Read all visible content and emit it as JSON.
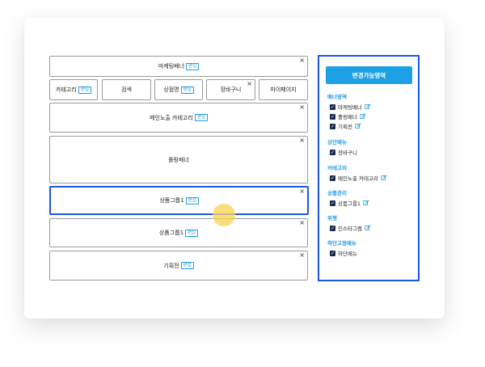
{
  "left": {
    "marketing_banner": {
      "label": "마케팅배너",
      "tag": "편집",
      "close": "×"
    },
    "category": {
      "label": "카테고리",
      "tag": "편집"
    },
    "search": {
      "label": "검색"
    },
    "product_name": {
      "label": "상점명",
      "tag": "편집"
    },
    "cart": {
      "label": "장바구니",
      "close": "×"
    },
    "mypage": {
      "label": "마이페이지"
    },
    "main_category": {
      "label": "메인노출 카테고리",
      "tag": "편집",
      "close": "×"
    },
    "rolling_banner": {
      "label": "롤링배너",
      "close": "×"
    },
    "product_group_1": {
      "label": "상품그룹1",
      "tag": "편집",
      "close": "×"
    },
    "product_group_2": {
      "label": "상품그룹1",
      "tag": "편집",
      "close": "×"
    },
    "special": {
      "label": "기획전",
      "tag": "편집",
      "close": "×"
    }
  },
  "right": {
    "button": "변경가능영역",
    "groups": [
      {
        "title": "배너영역",
        "items": [
          {
            "label": "마케팅배너",
            "edit": true
          },
          {
            "label": "롤링배너",
            "edit": true
          },
          {
            "label": "기획전",
            "edit": true
          }
        ]
      },
      {
        "title": "상단메뉴",
        "items": [
          {
            "label": "장바구니",
            "edit": false
          }
        ]
      },
      {
        "title": "카테고리",
        "items": [
          {
            "label": "메인노출 카테고리",
            "edit": true
          }
        ]
      },
      {
        "title": "상품관리",
        "items": [
          {
            "label": "상품그룹1",
            "edit": true
          }
        ]
      },
      {
        "title": "위젯",
        "items": [
          {
            "label": "인스타그램",
            "edit": true
          }
        ]
      },
      {
        "title": "하단고정메뉴",
        "items": [
          {
            "label": "하단메뉴",
            "edit": false
          }
        ]
      }
    ]
  },
  "colors": {
    "accent": "#1e9be0",
    "selection": "#1a56e6",
    "cursor": "#f8d45a"
  },
  "icons": {
    "close": "close-icon",
    "edit": "pencil-icon",
    "check": "checkbox-icon"
  }
}
